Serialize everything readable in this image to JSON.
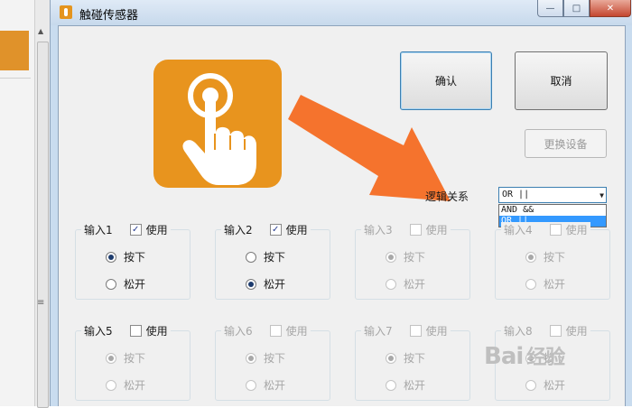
{
  "window": {
    "title": "触碰传感器",
    "caption": {
      "minimize": "—",
      "maximize": "□",
      "close": "✕"
    }
  },
  "buttons": {
    "confirm": "确认",
    "cancel": "取消",
    "replace_device": "更换设备"
  },
  "logic": {
    "label": "逻辑关系",
    "selected": "OR ||",
    "options": [
      "AND &&",
      "OR ||"
    ],
    "highlighted_index": 1
  },
  "inputs": [
    {
      "label": "输入1",
      "use_label": "使用",
      "enabled": true,
      "use_checked": true,
      "press": "按下",
      "release": "松开",
      "selected": "press"
    },
    {
      "label": "输入2",
      "use_label": "使用",
      "enabled": true,
      "use_checked": true,
      "press": "按下",
      "release": "松开",
      "selected": "release"
    },
    {
      "label": "输入3",
      "use_label": "使用",
      "enabled": false,
      "use_checked": false,
      "press": "按下",
      "release": "松开",
      "selected": "press"
    },
    {
      "label": "输入4",
      "use_label": "使用",
      "enabled": false,
      "use_checked": false,
      "press": "按下",
      "release": "松开",
      "selected": "press"
    },
    {
      "label": "输入5",
      "use_label": "使用",
      "enabled": false,
      "use_checked": false,
      "press": "按下",
      "release": "松开",
      "selected": "press"
    },
    {
      "label": "输入6",
      "use_label": "使用",
      "enabled": false,
      "use_checked": false,
      "press": "按下",
      "release": "松开",
      "selected": "press"
    },
    {
      "label": "输入7",
      "use_label": "使用",
      "enabled": false,
      "use_checked": false,
      "press": "按下",
      "release": "松开",
      "selected": "press"
    },
    {
      "label": "输入8",
      "use_label": "使用",
      "enabled": false,
      "use_checked": false,
      "press": "按下",
      "release": "松开",
      "selected": "press"
    }
  ],
  "watermark": {
    "text": "Bai",
    "sub": "经验"
  },
  "colors": {
    "accent_orange": "#e8941e",
    "arrow_orange": "#f5732d",
    "selection_blue": "#3399ff"
  }
}
